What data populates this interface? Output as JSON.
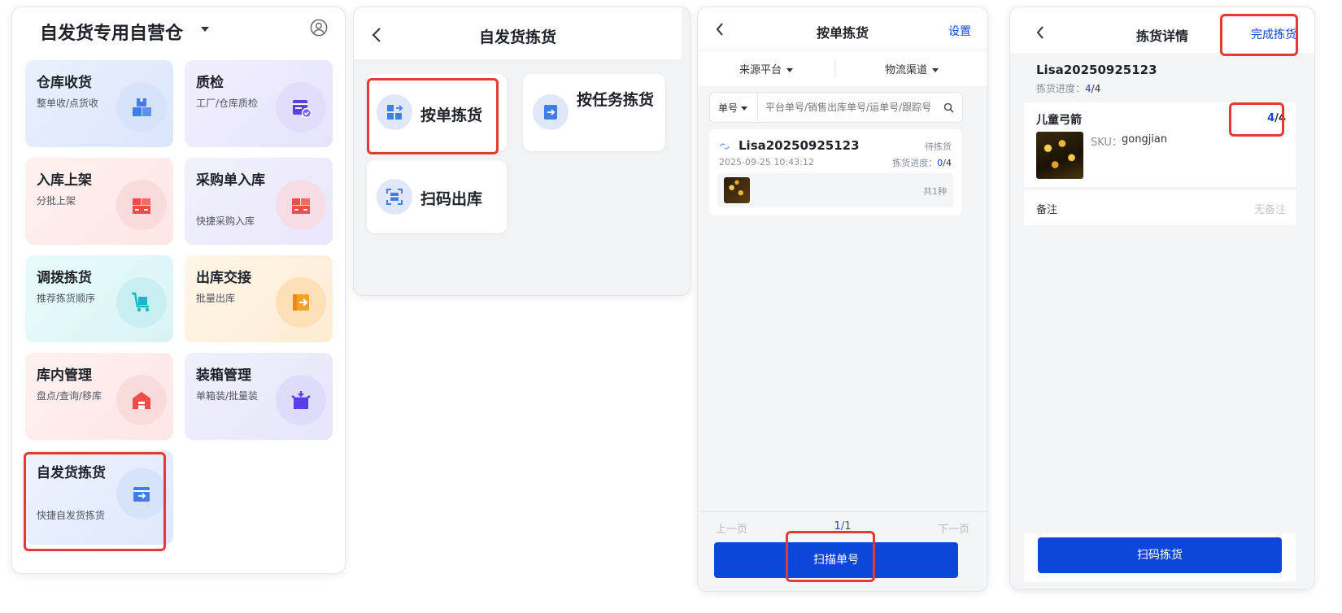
{
  "colors": {
    "accent": "#0d47d9",
    "highlight": "#e53935",
    "text": "#1f2329",
    "muted": "#8a8f99"
  },
  "panel1": {
    "title": "自发货专用自营仓",
    "user_icon": "user-circle-icon",
    "cards": [
      {
        "title": "仓库收货",
        "subtitle": "整单收/点货收",
        "icon": "boxes-icon"
      },
      {
        "title": "质检",
        "subtitle": "工厂/仓库质检",
        "icon": "inspection-box-icon"
      },
      {
        "title": "入库上架",
        "subtitle": "分批上架",
        "icon": "shelf-icon"
      },
      {
        "title": "采购单入库",
        "subtitle": "快捷采购入库",
        "icon": "shelf-icon"
      },
      {
        "title": "调拨拣货",
        "subtitle": "推荐拣货顺序",
        "icon": "cart-icon"
      },
      {
        "title": "出库交接",
        "subtitle": "批量出库",
        "icon": "outbound-icon"
      },
      {
        "title": "库内管理",
        "subtitle": "盘点/查询/移库",
        "icon": "warehouse-icon"
      },
      {
        "title": "装箱管理",
        "subtitle": "单箱装/批量装",
        "icon": "open-box-icon"
      },
      {
        "title": "自发货拣货",
        "subtitle": "快捷自发货拣货",
        "icon": "pick-box-icon"
      }
    ]
  },
  "panel2": {
    "title": "自发货拣货",
    "back_icon": "back-arrow-icon",
    "options": [
      {
        "label": "按单拣货",
        "icon": "grid-arrow-icon"
      },
      {
        "label": "按任务拣货",
        "icon": "task-arrow-icon"
      },
      {
        "label": "扫码出库",
        "icon": "scan-icon"
      }
    ]
  },
  "panel3": {
    "title": "按单拣货",
    "settings": "设置",
    "filters": [
      "来源平台",
      "物流渠道"
    ],
    "search_type": "单号",
    "search_placeholder": "平台单号/销售出库单号/运单号/跟踪号",
    "order": {
      "id": "Lisa20250925123",
      "status": "待拣货",
      "time": "2025-09-25 10:43:12",
      "progress_label": "拣货进度：",
      "progress_done": "0",
      "progress_total": "/4",
      "count": "共1种"
    },
    "pager": {
      "prev": "上一页",
      "current": "1",
      "total": "/1",
      "next": "下一页"
    },
    "scan_button": "扫描单号"
  },
  "panel4": {
    "title": "拣货详情",
    "complete": "完成拣货",
    "order_id": "Lisa20250925123",
    "progress_label": "拣货进度：",
    "progress_done": "4",
    "progress_total": "/4",
    "item": {
      "name": "儿童弓箭",
      "qty_done": "4",
      "qty_total": "/4",
      "sku_label": "SKU：",
      "sku": "gongjian"
    },
    "remark_label": "备注",
    "remark_value": "无备注",
    "scan_button": "扫码拣货"
  }
}
